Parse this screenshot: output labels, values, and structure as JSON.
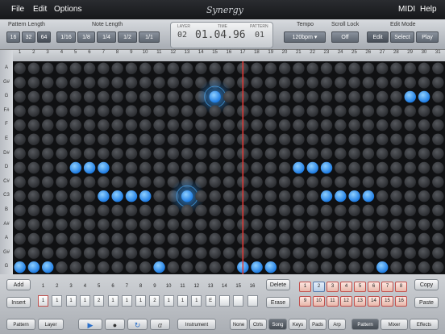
{
  "menu": {
    "file": "File",
    "edit": "Edit",
    "options": "Options",
    "midi": "MIDI",
    "help": "Help",
    "logo": "Synergy"
  },
  "pattern_length": {
    "label": "Pattern Length",
    "options": [
      "16",
      "32",
      "64"
    ],
    "selected": "64"
  },
  "note_length": {
    "label": "Note Length",
    "options": [
      "1/16",
      "1/8",
      "1/4",
      "1/2",
      "1/1"
    ]
  },
  "lcd": {
    "layer_label": "LAYER",
    "time_label": "TIME",
    "pattern_label": "PATTERN",
    "layer": "02",
    "time": "01.04.96",
    "pattern": "01"
  },
  "tempo": {
    "label": "Tempo",
    "value": "120bpm"
  },
  "scroll_lock": {
    "label": "Scroll Lock",
    "value": "Off"
  },
  "edit_mode": {
    "label": "Edit Mode",
    "options": [
      "Edit",
      "Select",
      "Play"
    ],
    "selected": "Edit"
  },
  "columns": [
    "1",
    "2",
    "3",
    "4",
    "5",
    "6",
    "7",
    "8",
    "9",
    "10",
    "11",
    "12",
    "13",
    "14",
    "15",
    "16",
    "17",
    "18",
    "19",
    "20",
    "21",
    "22",
    "23",
    "24",
    "25",
    "26",
    "27",
    "28",
    "29",
    "30",
    "31"
  ],
  "rows": [
    "A",
    "G#",
    "G",
    "F#",
    "F",
    "E",
    "D#",
    "D",
    "C#",
    "C3",
    "B",
    "A#",
    "A",
    "G#",
    "G"
  ],
  "notes": [
    {
      "row": 2,
      "col": 15,
      "big": true
    },
    {
      "row": 2,
      "col": 29
    },
    {
      "row": 2,
      "col": 30
    },
    {
      "row": 7,
      "col": 5
    },
    {
      "row": 7,
      "col": 6
    },
    {
      "row": 7,
      "col": 7
    },
    {
      "row": 7,
      "col": 21
    },
    {
      "row": 7,
      "col": 22
    },
    {
      "row": 7,
      "col": 23
    },
    {
      "row": 9,
      "col": 7
    },
    {
      "row": 9,
      "col": 8
    },
    {
      "row": 9,
      "col": 9
    },
    {
      "row": 9,
      "col": 10
    },
    {
      "row": 9,
      "col": 13,
      "big": true
    },
    {
      "row": 9,
      "col": 23
    },
    {
      "row": 9,
      "col": 24
    },
    {
      "row": 9,
      "col": 25
    },
    {
      "row": 9,
      "col": 26
    },
    {
      "row": 14,
      "col": 1
    },
    {
      "row": 14,
      "col": 2
    },
    {
      "row": 14,
      "col": 3
    },
    {
      "row": 14,
      "col": 11
    },
    {
      "row": 14,
      "col": 17
    },
    {
      "row": 14,
      "col": 18
    },
    {
      "row": 14,
      "col": 19
    },
    {
      "row": 14,
      "col": 27
    }
  ],
  "playhead": {
    "col": 17
  },
  "bottom": {
    "add": "Add",
    "insert": "Insert",
    "delete": "Delete",
    "erase": "Erase",
    "copy": "Copy",
    "paste": "Paste",
    "step_numbers": [
      "1",
      "2",
      "3",
      "4",
      "5",
      "6",
      "7",
      "8",
      "9",
      "10",
      "11",
      "12",
      "13",
      "14",
      "15",
      "16"
    ],
    "step_values": [
      "1",
      "1",
      "1",
      "1",
      "2",
      "1",
      "1",
      "1",
      "2",
      "1",
      "1",
      "1",
      "E",
      "",
      "",
      ""
    ],
    "patterns": [
      "1",
      "2",
      "3",
      "4",
      "5",
      "6",
      "7",
      "8",
      "9",
      "10",
      "11",
      "12",
      "13",
      "14",
      "15",
      "16"
    ],
    "selected_pattern": "2",
    "tabs_left": [
      "Pattern",
      "Layer"
    ],
    "instrument": "Instrument",
    "view_tabs": [
      "None",
      "Ctrls",
      "Song",
      "Keys",
      "Pads",
      "Arp"
    ],
    "view_selected": "Song",
    "right_tabs": [
      "Pattern",
      "Mixer",
      "Effects"
    ],
    "right_selected": "Pattern"
  },
  "colors": {
    "note": "#1e90ff",
    "playhead": "#e53935",
    "cell": "#3a3c40"
  }
}
